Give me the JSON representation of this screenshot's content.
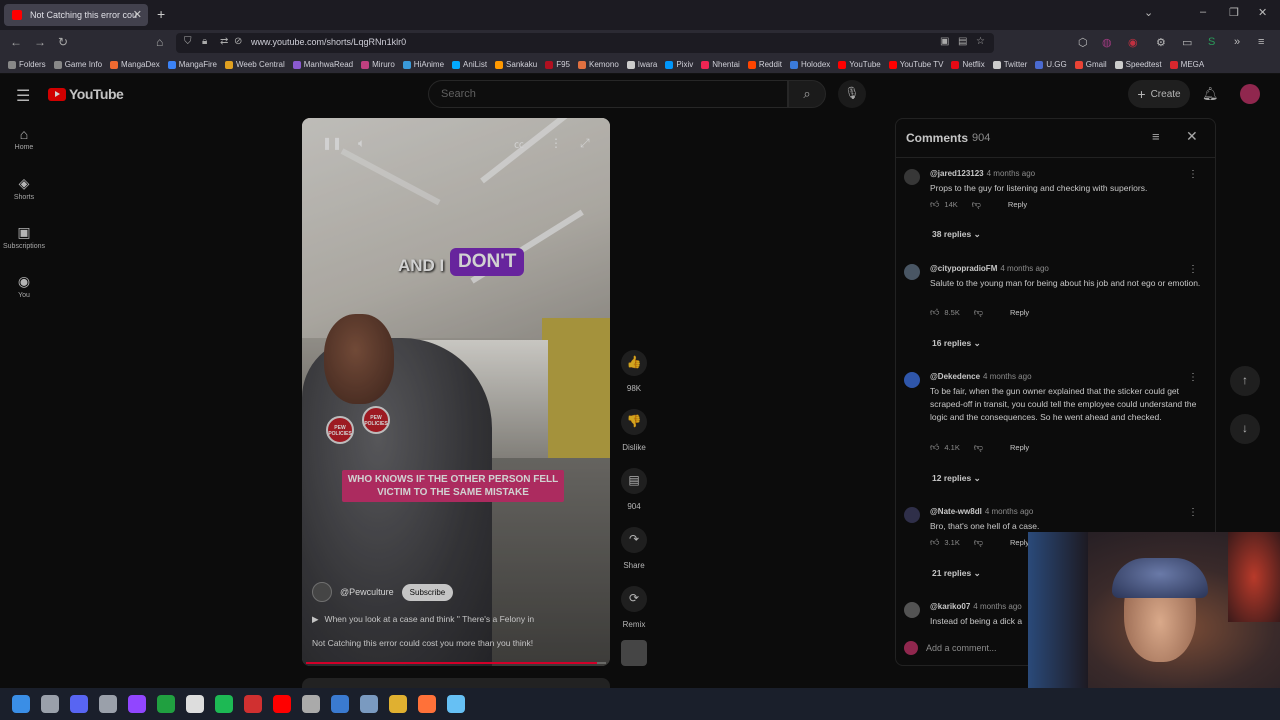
{
  "browser": {
    "tab_title": "Not Catching this error cou",
    "url": "www.youtube.com/shorts/LqgRNn1klr0",
    "bookmarks": [
      {
        "label": "Folders",
        "color": "#888888"
      },
      {
        "label": "Game Info",
        "color": "#888888"
      },
      {
        "label": "MangaDex",
        "color": "#f06a31"
      },
      {
        "label": "MangaFire",
        "color": "#3b82f6"
      },
      {
        "label": "Weeb Central",
        "color": "#e0a020"
      },
      {
        "label": "ManhwaRead",
        "color": "#8a5ad0"
      },
      {
        "label": "Miruro",
        "color": "#c04080"
      },
      {
        "label": "HiAnime",
        "color": "#3a9ad9"
      },
      {
        "label": "AniList",
        "color": "#02a9ff"
      },
      {
        "label": "Sankaku",
        "color": "#ff9900"
      },
      {
        "label": "F95",
        "color": "#b01020"
      },
      {
        "label": "Kemono",
        "color": "#e07040"
      },
      {
        "label": "Iwara",
        "color": "#cccccc"
      },
      {
        "label": "Pixiv",
        "color": "#0096fa"
      },
      {
        "label": "Nhentai",
        "color": "#ed2553"
      },
      {
        "label": "Reddit",
        "color": "#ff4500"
      },
      {
        "label": "Holodex",
        "color": "#3a7ad9"
      },
      {
        "label": "YouTube",
        "color": "#ff0000"
      },
      {
        "label": "YouTube TV",
        "color": "#ff0000"
      },
      {
        "label": "Netflix",
        "color": "#e50914"
      },
      {
        "label": "Twitter",
        "color": "#cccccc"
      },
      {
        "label": "U.GG",
        "color": "#4a6ad0"
      },
      {
        "label": "Gmail",
        "color": "#ea4335"
      },
      {
        "label": "Speedtest",
        "color": "#cccccc"
      },
      {
        "label": "MEGA",
        "color": "#d9272e"
      }
    ]
  },
  "youtube": {
    "logo_text": "YouTube",
    "search_placeholder": "Search",
    "create_label": "Create",
    "guide": [
      {
        "label": "Home",
        "icon": "⌂"
      },
      {
        "label": "Shorts",
        "icon": "◈"
      },
      {
        "label": "Subscriptions",
        "icon": "▣"
      },
      {
        "label": "You",
        "icon": "◉"
      }
    ]
  },
  "video": {
    "caption_top_left": "AND I",
    "caption_top_highlight": "DON'T",
    "caption_bottom": "WHO KNOWS IF THE OTHER PERSON FELL VICTIM TO THE SAME MISTAKE",
    "badge_text": "PEW POLICIES",
    "channel": "@Pewculture",
    "subscribe_label": "Subscribe",
    "description": "When you look at a case and think \" There's a Felony in",
    "title": "Not Catching this error could cost you more than you think!",
    "progress": 0.97
  },
  "actions": [
    {
      "name": "like",
      "icon": "👍",
      "label": "98K"
    },
    {
      "name": "dislike",
      "icon": "👎",
      "label": "Dislike"
    },
    {
      "name": "comments",
      "icon": "▤",
      "label": "904"
    },
    {
      "name": "share",
      "icon": "↷",
      "label": "Share"
    },
    {
      "name": "remix",
      "icon": "⟳",
      "label": "Remix"
    }
  ],
  "comments": {
    "heading": "Comments",
    "count": "904",
    "items": [
      {
        "user": "@jared123123",
        "time": "4 months ago",
        "text": "Props to the guy for listening and checking with superiors.",
        "likes": "14K",
        "replies": "38 replies",
        "avatar_color": "#444444"
      },
      {
        "user": "@citypopradioFM",
        "time": "4 months ago",
        "text": "Salute to the young man for being about his job and not ego or emotion.",
        "likes": "8.5K",
        "replies": "16 replies",
        "avatar_color": "#5a6a7a"
      },
      {
        "user": "@Dekedence",
        "time": "4 months ago",
        "text": "To be fair, when the gun owner explained that the sticker could get scraped-off in transit, you could tell the employee could understand the logic and the consequences. So he went ahead and checked.",
        "likes": "4.1K",
        "replies": "12 replies",
        "avatar_color": "#3a6ad0"
      },
      {
        "user": "@Nate-ww8dl",
        "time": "4 months ago",
        "text": "Bro, that's one hell of a case.",
        "likes": "3.1K",
        "replies": "21 replies",
        "avatar_color": "#3a3a5a"
      },
      {
        "user": "@kariko07",
        "time": "4 months ago",
        "text": "Instead of being a dick a",
        "likes": "",
        "replies": "",
        "avatar_color": "#666666"
      }
    ],
    "reply_label": "Reply",
    "add_placeholder": "Add a comment..."
  },
  "taskbar": {
    "icons": [
      {
        "name": "start",
        "color": "#3a8ee6"
      },
      {
        "name": "search",
        "color": "#9aa0aa"
      },
      {
        "name": "discord",
        "color": "#5865f2"
      },
      {
        "name": "settings",
        "color": "#9aa0aa"
      },
      {
        "name": "twitch",
        "color": "#9146ff"
      },
      {
        "name": "app-green",
        "color": "#20a040"
      },
      {
        "name": "x",
        "color": "#dddddd"
      },
      {
        "name": "spotify",
        "color": "#1db954"
      },
      {
        "name": "app-red",
        "color": "#d03030"
      },
      {
        "name": "youtube",
        "color": "#ff0000"
      },
      {
        "name": "player",
        "color": "#aaaaaa"
      },
      {
        "name": "app-blue",
        "color": "#3a7ad0"
      },
      {
        "name": "shield",
        "color": "#7a9ac0"
      },
      {
        "name": "folder",
        "color": "#e0b030"
      },
      {
        "name": "firefox",
        "color": "#ff7139"
      },
      {
        "name": "steam",
        "color": "#66c0f4"
      }
    ]
  }
}
